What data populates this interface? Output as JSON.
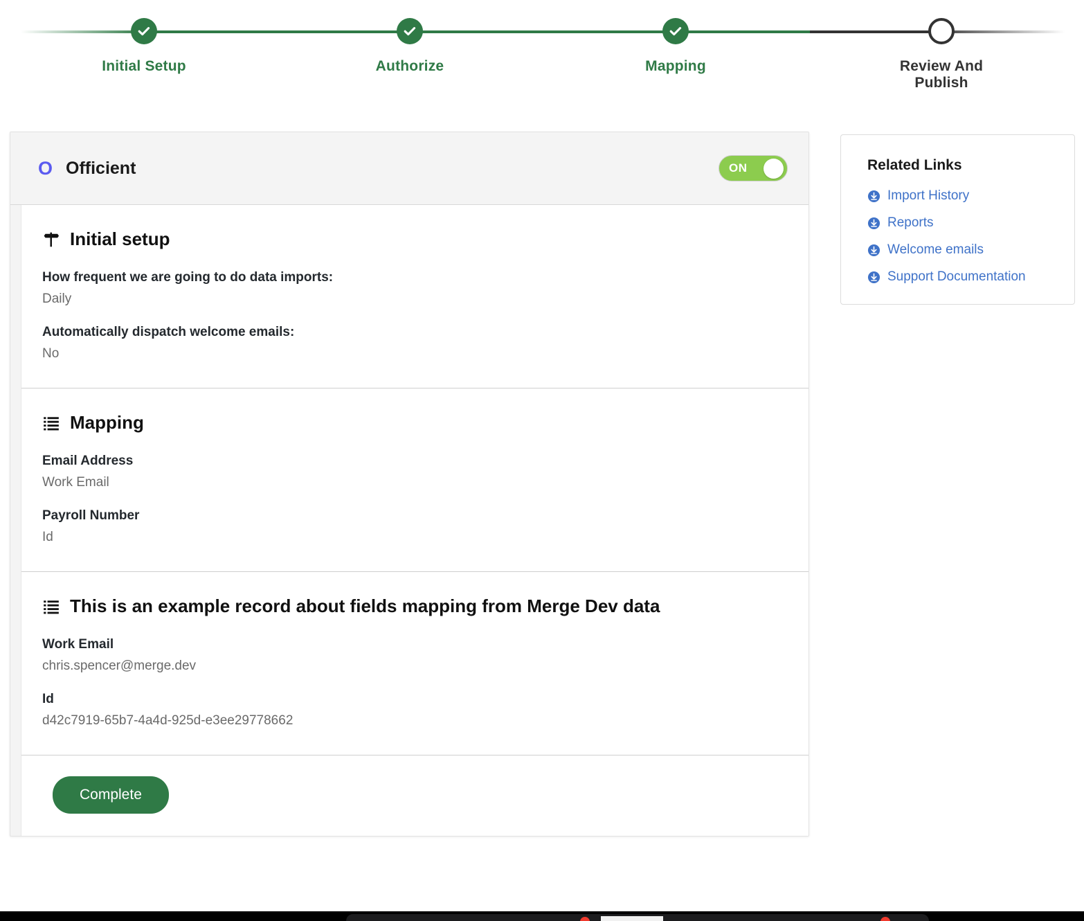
{
  "stepper": {
    "steps": [
      {
        "label": "Initial Setup",
        "state": "done",
        "icon": "check-icon"
      },
      {
        "label": "Authorize",
        "state": "done",
        "icon": "check-icon"
      },
      {
        "label": "Mapping",
        "state": "done",
        "icon": "check-icon"
      },
      {
        "label": "Review And Publish",
        "state": "pending",
        "icon": "empty-circle-icon"
      }
    ],
    "colors": {
      "done": "#2f7a46",
      "pending": "#333333"
    }
  },
  "card": {
    "header": {
      "logo_glyph": "O",
      "logo_color": "#5b5bf0",
      "brand_name": "Officient",
      "toggle": {
        "label": "ON",
        "state": "on",
        "color": "#8ccc4e"
      }
    },
    "sections": [
      {
        "title": "Initial setup",
        "icon": "signpost-icon",
        "fields": [
          {
            "label": "How frequent we are going to do data imports:",
            "value": "Daily"
          },
          {
            "label": "Automatically dispatch welcome emails:",
            "value": "No"
          }
        ]
      },
      {
        "title": "Mapping",
        "icon": "list-icon",
        "fields": [
          {
            "label": "Email Address",
            "value": "Work Email"
          },
          {
            "label": "Payroll Number",
            "value": "Id"
          }
        ]
      },
      {
        "title": "This is an example record about fields mapping from Merge Dev data",
        "icon": "list-icon",
        "fields": [
          {
            "label": "Work Email",
            "value": "chris.spencer@merge.dev"
          },
          {
            "label": "Id",
            "value": "d42c7919-65b7-4a4d-925d-e3ee29778662"
          }
        ]
      }
    ],
    "footer": {
      "complete_label": "Complete",
      "complete_color": "#2f7a46"
    }
  },
  "related_links": {
    "title": "Related Links",
    "link_color": "#3f72c8",
    "items": [
      {
        "label": "Import History",
        "icon": "download-circle-icon"
      },
      {
        "label": "Reports",
        "icon": "download-circle-icon"
      },
      {
        "label": "Welcome emails",
        "icon": "download-circle-icon"
      },
      {
        "label": "Support Documentation",
        "icon": "download-circle-icon"
      }
    ]
  }
}
